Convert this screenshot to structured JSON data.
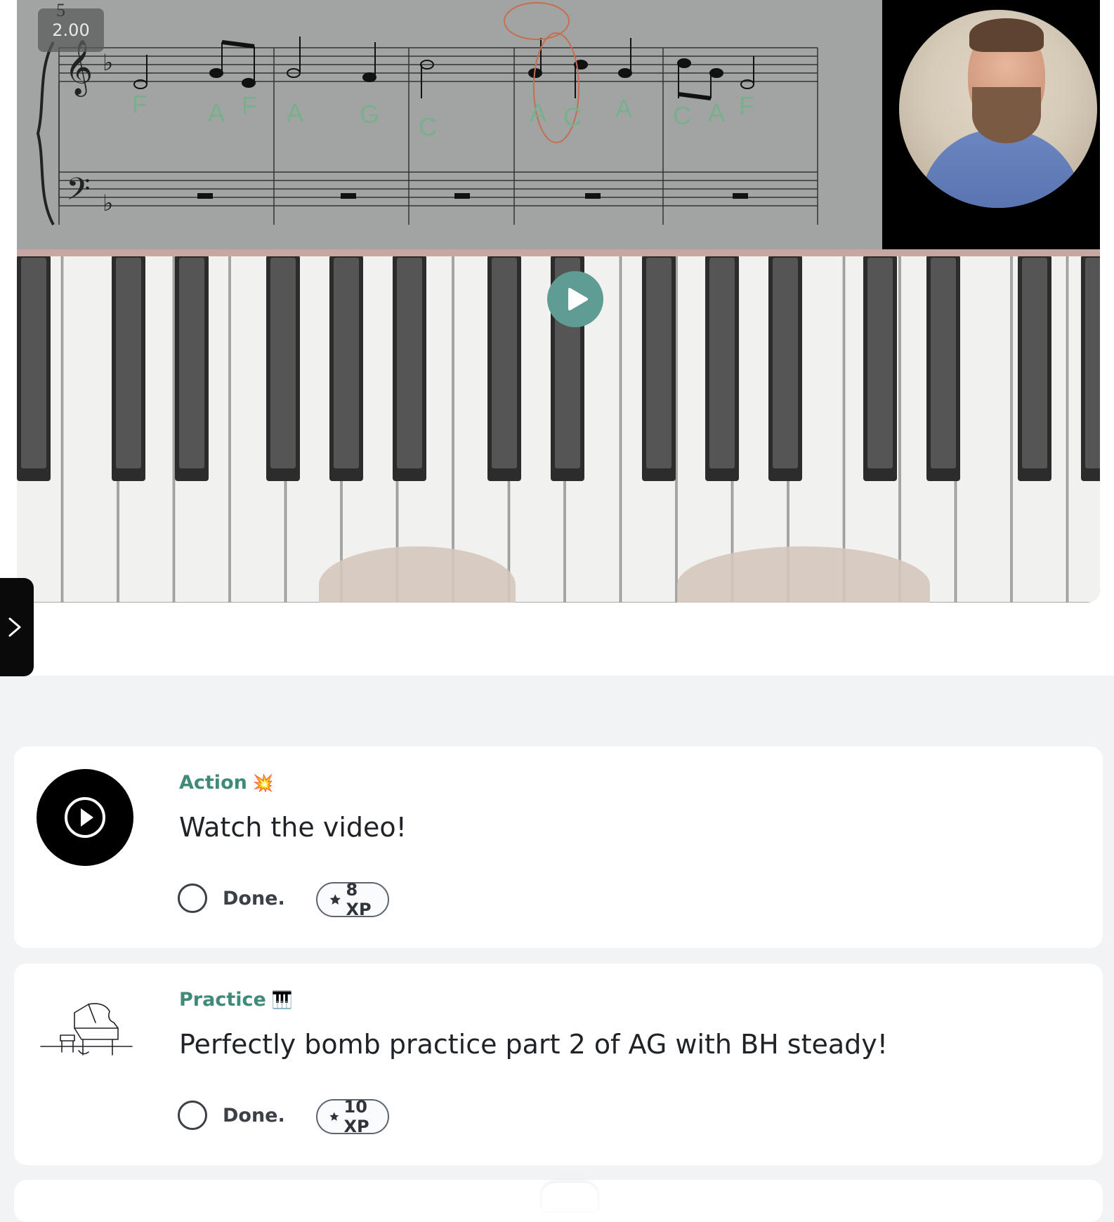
{
  "video": {
    "speed": "2.00",
    "measure_number": "5",
    "note_letters": [
      "F",
      "A",
      "F",
      "A",
      "G",
      "C",
      "A",
      "C",
      "A",
      "C",
      "A",
      "F"
    ]
  },
  "cards": [
    {
      "category": "Action",
      "category_emoji": "💥",
      "title": "Watch the video!",
      "done_label": "Done.",
      "xp": "8 XP",
      "icon": "play-circle-icon"
    },
    {
      "category": "Practice",
      "category_emoji": "🎹",
      "title": "Perfectly bomb practice part 2 of AG with BH steady!",
      "done_label": "Done.",
      "xp": "10 XP",
      "icon": "grand-piano-icon"
    }
  ],
  "colors": {
    "accent_green": "#3f8a78",
    "play_button": "#5f9c93",
    "page_bg": "#f2f3f5"
  }
}
